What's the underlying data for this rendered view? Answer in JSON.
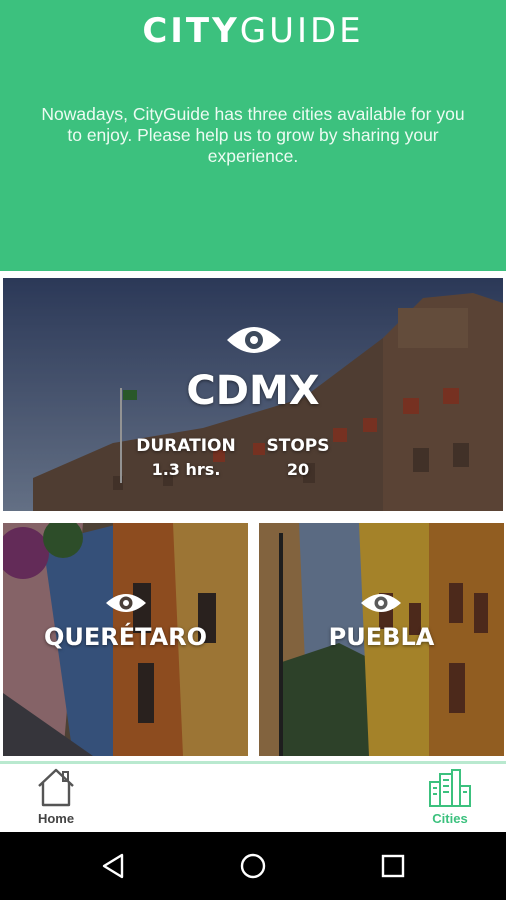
{
  "app": {
    "logo_bold": "CITY",
    "logo_thin": "GUIDE",
    "intro_text": "Nowadays, CityGuide has three cities available for you to enjoy. Please help us to grow by sharing your experience."
  },
  "cities": [
    {
      "name": "CDMX",
      "duration_label": "DURATION",
      "duration_value": "1.3 hrs.",
      "stops_label": "STOPS",
      "stops_value": "20"
    },
    {
      "name": "QUERÉTARO"
    },
    {
      "name": "PUEBLA"
    }
  ],
  "bottom_nav": {
    "items": [
      {
        "label": "Home",
        "icon": "house-icon",
        "active": false
      },
      {
        "label": "Cities",
        "icon": "city-buildings-icon",
        "active": true
      }
    ]
  },
  "system_nav": {
    "icons": [
      "back-icon",
      "home-circle-icon",
      "recents-square-icon"
    ]
  },
  "colors": {
    "accent": "#3cc17e",
    "system_bar": "#000000"
  }
}
